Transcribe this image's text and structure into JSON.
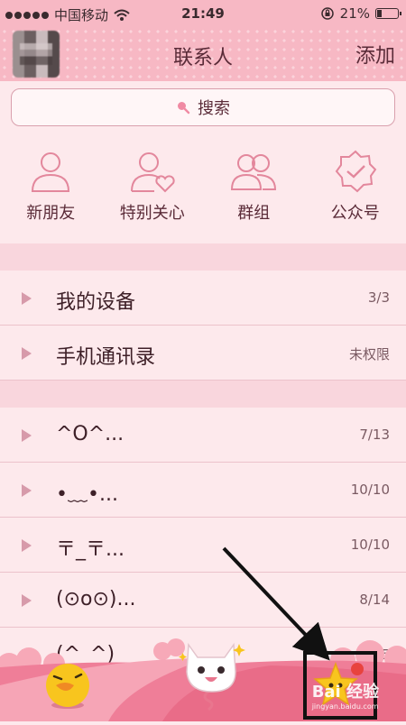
{
  "status": {
    "carrier": "中国移动",
    "time": "21:49",
    "battery": "21%"
  },
  "nav": {
    "title": "联系人",
    "add_label": "添加"
  },
  "search": {
    "label": "搜索"
  },
  "quick": [
    {
      "label": "新朋友"
    },
    {
      "label": "特别关心"
    },
    {
      "label": "群组"
    },
    {
      "label": "公众号"
    }
  ],
  "groups_top": [
    {
      "name": "我的设备",
      "count": "3/3"
    },
    {
      "name": "手机通讯录",
      "count": "未权限"
    }
  ],
  "groups": [
    {
      "name": "^O^...",
      "count": "7/13"
    },
    {
      "name": "•﹏•...",
      "count": "10/10"
    },
    {
      "name": "〒_〒...",
      "count": "10/10"
    },
    {
      "name": "(⊙o⊙)...",
      "count": "8/14"
    },
    {
      "name": "(^_^)",
      "count": "15"
    }
  ],
  "watermark": {
    "text": "Bai 经验",
    "url": "jingyan.baidu.com"
  },
  "colors": {
    "accent": "#f7b8c4",
    "text": "#5a2b38"
  }
}
